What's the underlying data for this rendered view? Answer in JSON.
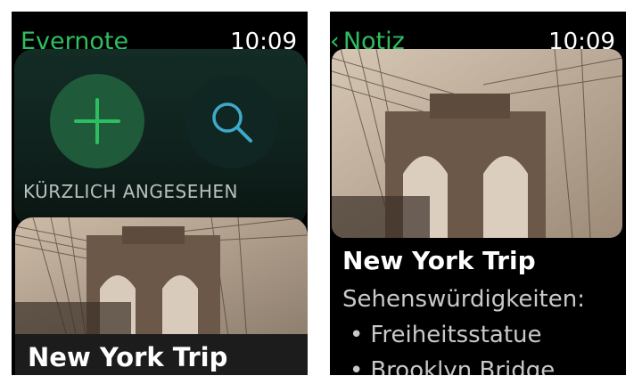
{
  "left_screen": {
    "app_title": "Evernote",
    "time": "10:09",
    "actions": {
      "new_note_icon": "plus-icon",
      "search_icon": "magnifier-icon"
    },
    "recent_header": "KÜRZLICH ANGESEHEN",
    "recent_note": {
      "title": "New York Trip"
    }
  },
  "right_screen": {
    "back_chevron": "‹",
    "back_label": "Notiz",
    "time": "10:09",
    "note": {
      "title": "New York Trip",
      "heading": "Sehenswürdigkeiten:",
      "bullet_char": "•",
      "items": [
        "Freiheitsstatue",
        "Brooklyn Bridge"
      ]
    }
  },
  "colors": {
    "accent_green": "#2dbe60",
    "search_blue": "#3fa9c9",
    "background": "#000000"
  }
}
